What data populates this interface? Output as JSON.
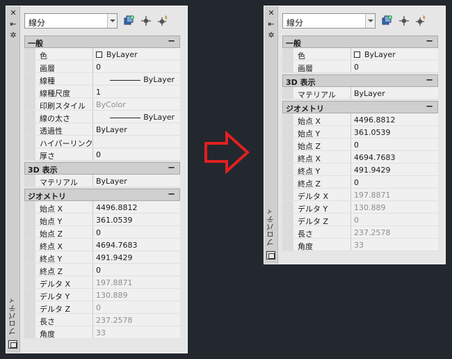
{
  "left": {
    "combo": "線分",
    "vertical_title": "プロパティ",
    "categories": [
      {
        "label": "一般",
        "rows": [
          {
            "k": "色",
            "v": "ByLayer",
            "style": "box"
          },
          {
            "k": "画層",
            "v": "0"
          },
          {
            "k": "線種",
            "v": "ByLayer",
            "style": "line"
          },
          {
            "k": "線種尺度",
            "v": "1"
          },
          {
            "k": "印刷スタイル",
            "v": "ByColor",
            "style": "gray"
          },
          {
            "k": "線の太さ",
            "v": "ByLayer",
            "style": "line"
          },
          {
            "k": "透過性",
            "v": "ByLayer"
          },
          {
            "k": "ハイパーリンク",
            "v": ""
          },
          {
            "k": "厚さ",
            "v": "0"
          }
        ]
      },
      {
        "label": "3D 表示",
        "rows": [
          {
            "k": "マテリアル",
            "v": "ByLayer"
          }
        ]
      },
      {
        "label": "ジオメトリ",
        "rows": [
          {
            "k": "始点 X",
            "v": "4496.8812"
          },
          {
            "k": "始点 Y",
            "v": "361.0539"
          },
          {
            "k": "始点 Z",
            "v": "0"
          },
          {
            "k": "終点 X",
            "v": "4694.7683"
          },
          {
            "k": "終点 Y",
            "v": "491.9429"
          },
          {
            "k": "終点 Z",
            "v": "0"
          },
          {
            "k": "デルタ X",
            "v": "197.8871",
            "style": "gray"
          },
          {
            "k": "デルタ Y",
            "v": "130.889",
            "style": "gray"
          },
          {
            "k": "デルタ Z",
            "v": "0",
            "style": "gray"
          },
          {
            "k": "長さ",
            "v": "237.2578",
            "style": "gray"
          },
          {
            "k": "角度",
            "v": "33",
            "style": "gray"
          }
        ]
      }
    ]
  },
  "right": {
    "combo": "線分",
    "vertical_title": "プロパティ",
    "categories": [
      {
        "label": "一般",
        "rows": [
          {
            "k": "色",
            "v": "ByLayer",
            "style": "box"
          },
          {
            "k": "画層",
            "v": "0"
          }
        ]
      },
      {
        "label": "3D 表示",
        "rows": [
          {
            "k": "マテリアル",
            "v": "ByLayer"
          }
        ]
      },
      {
        "label": "ジオメトリ",
        "rows": [
          {
            "k": "始点 X",
            "v": "4496.8812"
          },
          {
            "k": "始点 Y",
            "v": "361.0539"
          },
          {
            "k": "始点 Z",
            "v": "0"
          },
          {
            "k": "終点 X",
            "v": "4694.7683"
          },
          {
            "k": "終点 Y",
            "v": "491.9429"
          },
          {
            "k": "終点 Z",
            "v": "0"
          },
          {
            "k": "デルタ X",
            "v": "197.8871",
            "style": "gray"
          },
          {
            "k": "デルタ Y",
            "v": "130.889",
            "style": "gray"
          },
          {
            "k": "デルタ Z",
            "v": "0",
            "style": "gray"
          },
          {
            "k": "長さ",
            "v": "237.2578",
            "style": "gray"
          },
          {
            "k": "角度",
            "v": "33",
            "style": "gray"
          }
        ]
      }
    ]
  },
  "colors": {
    "arrow": "#e02020",
    "background": "#23272e"
  },
  "icons": [
    "close-icon",
    "pin-icon",
    "settings-icon",
    "quick-select-icon",
    "select-objects-icon",
    "pickadd-toggle-icon",
    "palette-icon"
  ]
}
